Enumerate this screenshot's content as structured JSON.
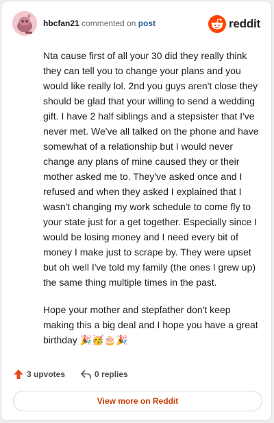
{
  "comment": {
    "username": "hbcfan21",
    "commented_on_text": "commented on",
    "post_link_text": "post",
    "paragraphs": [
      "Nta cause first of all your 30 did they really think they can tell you to change your plans and you would like really lol. 2nd you guys aren't close they should be glad that your willing to send a wedding gift. I have 2 half siblings and a stepsister that I've never met. We've all talked on the phone and have somewhat of a relationship but I would never change any plans of mine caused they or their mother asked me to. They've asked once and I refused and when they asked I explained that I wasn't changing my work schedule to come fly to your state just for a get together. Especially since I would be losing money and I need every bit of money I make just to scrape by. They were upset but oh well I've told my family (the ones I grew up) the same thing multiple times in the past.",
      "Hope your mother and stepfather don't keep making this a big deal and I hope you have a great birthday 🎉🥳🎂🎉"
    ]
  },
  "brand": {
    "name": "reddit",
    "logo_icon": "reddit-snoo-icon",
    "color": "#ff4500"
  },
  "actions": {
    "upvotes_label": "3 upvotes",
    "replies_label": "0 replies",
    "upvote_icon": "upvote-arrow-icon",
    "upvote_color": "#e8481c",
    "reply_icon": "reply-arrow-icon"
  },
  "footer": {
    "view_more_label": "View more on Reddit",
    "color": "#c83a00"
  }
}
